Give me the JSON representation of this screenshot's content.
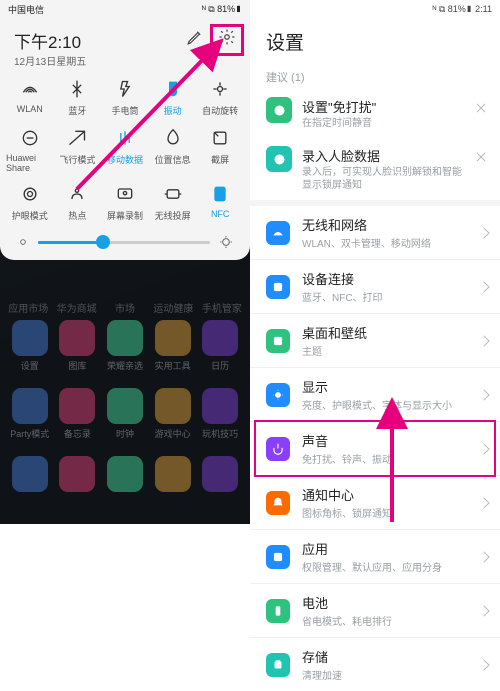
{
  "left": {
    "status": {
      "carrier": "中国电信",
      "indicators": "ᴺ ⧉ 81%▮"
    },
    "time": "下午2:10",
    "date": "12月13日星期五",
    "qs": [
      {
        "label": "WLAN",
        "active": false
      },
      {
        "label": "蓝牙",
        "active": false
      },
      {
        "label": "手电筒",
        "active": false
      },
      {
        "label": "振动",
        "active": true
      },
      {
        "label": "自动旋转",
        "active": false
      },
      {
        "label": "Huawei Share",
        "active": false
      },
      {
        "label": "飞行模式",
        "active": false
      },
      {
        "label": "移动数据",
        "active": true
      },
      {
        "label": "位置信息",
        "active": false
      },
      {
        "label": "截屏",
        "active": false
      },
      {
        "label": "护眼模式",
        "active": false
      },
      {
        "label": "热点",
        "active": false
      },
      {
        "label": "屏幕录制",
        "active": false
      },
      {
        "label": "无线投屏",
        "active": false
      },
      {
        "label": "NFC",
        "active": true
      }
    ],
    "home_tabs": [
      "应用市场",
      "华为商城",
      "市场",
      "运动健康",
      "手机管家"
    ],
    "apps": [
      [
        "设置",
        "图库",
        "荣耀亲选",
        "实用工具",
        "日历"
      ],
      [
        "Party模式",
        "备忘录",
        "时钟",
        "游戏中心",
        "玩机技巧"
      ],
      [
        "",
        "",
        "",
        "",
        ""
      ]
    ]
  },
  "right": {
    "status": {
      "indicators": "ᴺ ⧉ 81%▮ 2:11"
    },
    "title": "设置",
    "suggestions_label": "建议 (1)",
    "sugg": [
      {
        "title": "设置\"免打扰\"",
        "sub": "在指定时间静音",
        "color": "#2ec27e"
      },
      {
        "title": "录入人脸数据",
        "sub": "录入后，可实现人脸识别解锁和智能显示锁屏通知",
        "color": "#20c4b0"
      }
    ],
    "rows": [
      {
        "title": "无线和网络",
        "sub": "WLAN、双卡管理、移动网络",
        "color": "#1f8cff"
      },
      {
        "title": "设备连接",
        "sub": "蓝牙、NFC、打印",
        "color": "#1f8cff"
      },
      {
        "title": "桌面和壁纸",
        "sub": "主题",
        "color": "#2ec27e"
      },
      {
        "title": "显示",
        "sub": "亮度、护眼模式、字体与显示大小",
        "color": "#1f8cff"
      },
      {
        "title": "声音",
        "sub": "免打扰、铃声、振动",
        "color": "#8a3ffc",
        "highlight": true
      },
      {
        "title": "通知中心",
        "sub": "图标角标、锁屏通知",
        "color": "#ff6a00"
      },
      {
        "title": "应用",
        "sub": "权限管理、默认应用、应用分身",
        "color": "#1f8cff"
      },
      {
        "title": "电池",
        "sub": "省电模式、耗电排行",
        "color": "#2ec27e"
      },
      {
        "title": "存储",
        "sub": "清理加速",
        "color": "#20c4b0"
      }
    ]
  }
}
